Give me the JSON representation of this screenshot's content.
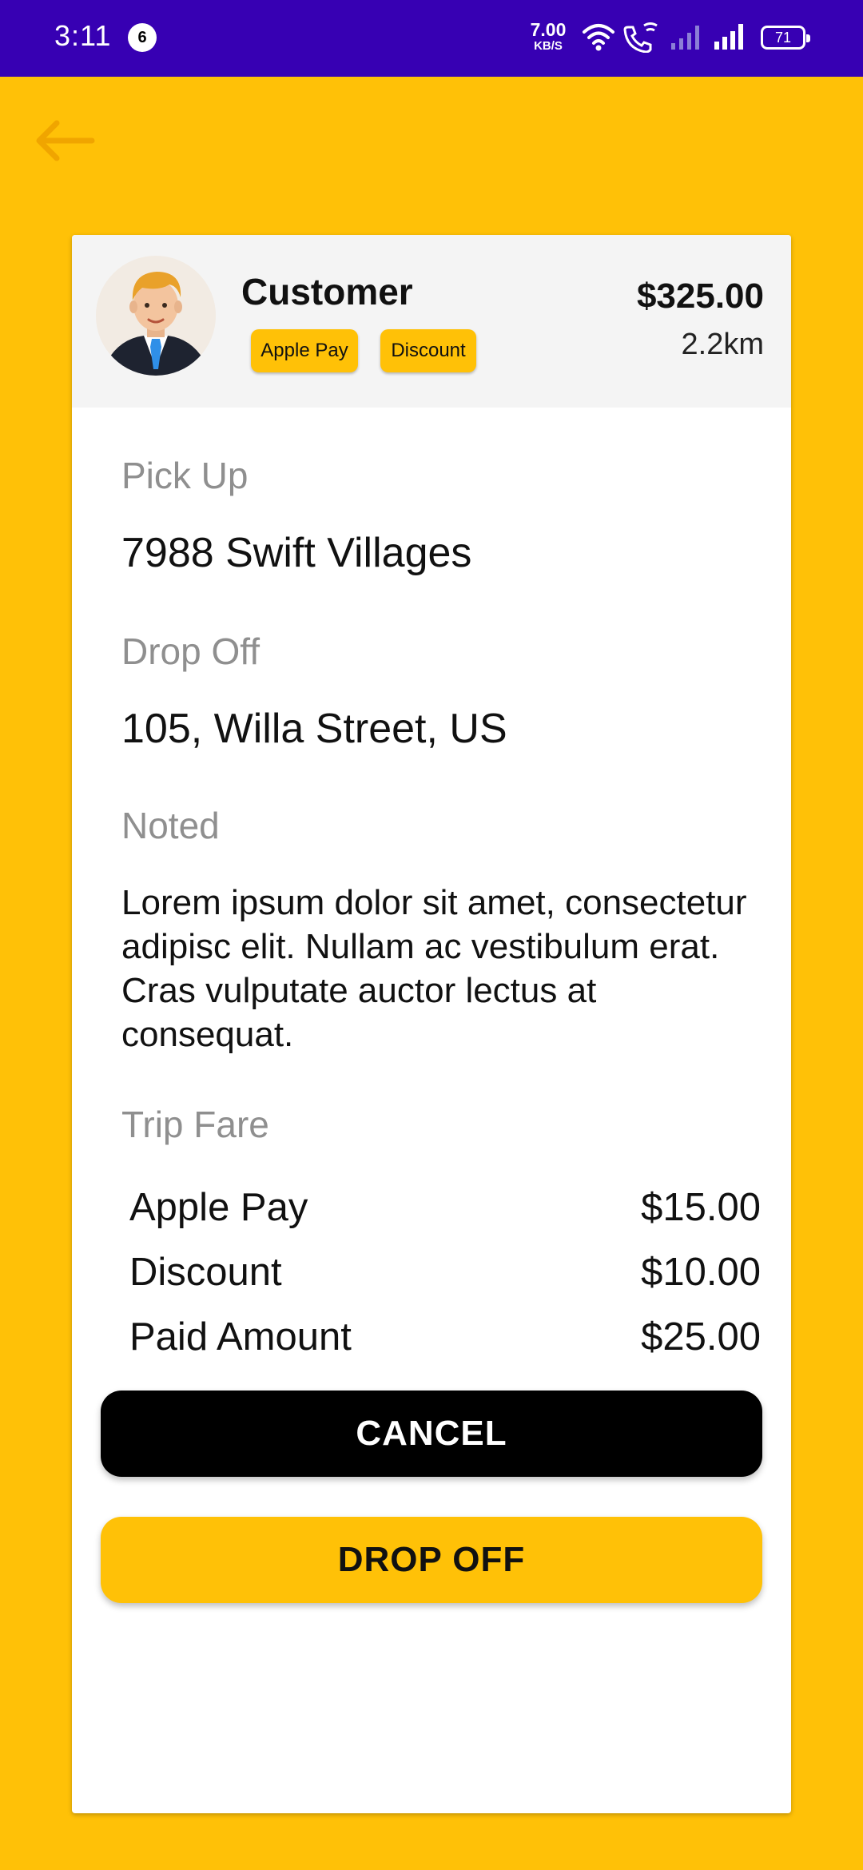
{
  "status_bar": {
    "time": "3:11",
    "notification_count": "6",
    "net_speed_value": "7.00",
    "net_speed_unit": "KB/S",
    "battery": "71"
  },
  "colors": {
    "status_bar": "#3700B3",
    "background": "#FFC107",
    "accent": "#FFC107",
    "cancel_button": "#000000"
  },
  "header": {
    "back_icon": "arrow-left-icon"
  },
  "customer": {
    "avatar_icon": "businessman-avatar",
    "name": "Customer",
    "tags": [
      "Apple Pay",
      "Discount"
    ],
    "price": "$325.00",
    "distance": "2.2km"
  },
  "trip": {
    "pickup_label": "Pick Up",
    "pickup_value": "7988 Swift Villages",
    "dropoff_label": "Drop Off",
    "dropoff_value": "105, Willa Street, US",
    "note_label": "Noted",
    "note_value": "Lorem ipsum dolor sit amet, consectetur adipisc elit. Nullam ac vestibulum erat. Cras vulputate auctor lectus at consequat."
  },
  "fare": {
    "label": "Trip Fare",
    "rows": [
      {
        "name": "Apple Pay",
        "amount": "$15.00"
      },
      {
        "name": "Discount",
        "amount": "$10.00"
      },
      {
        "name": "Paid Amount",
        "amount": "$25.00"
      }
    ]
  },
  "actions": {
    "cancel_label": "CANCEL",
    "dropoff_label": "DROP OFF"
  }
}
